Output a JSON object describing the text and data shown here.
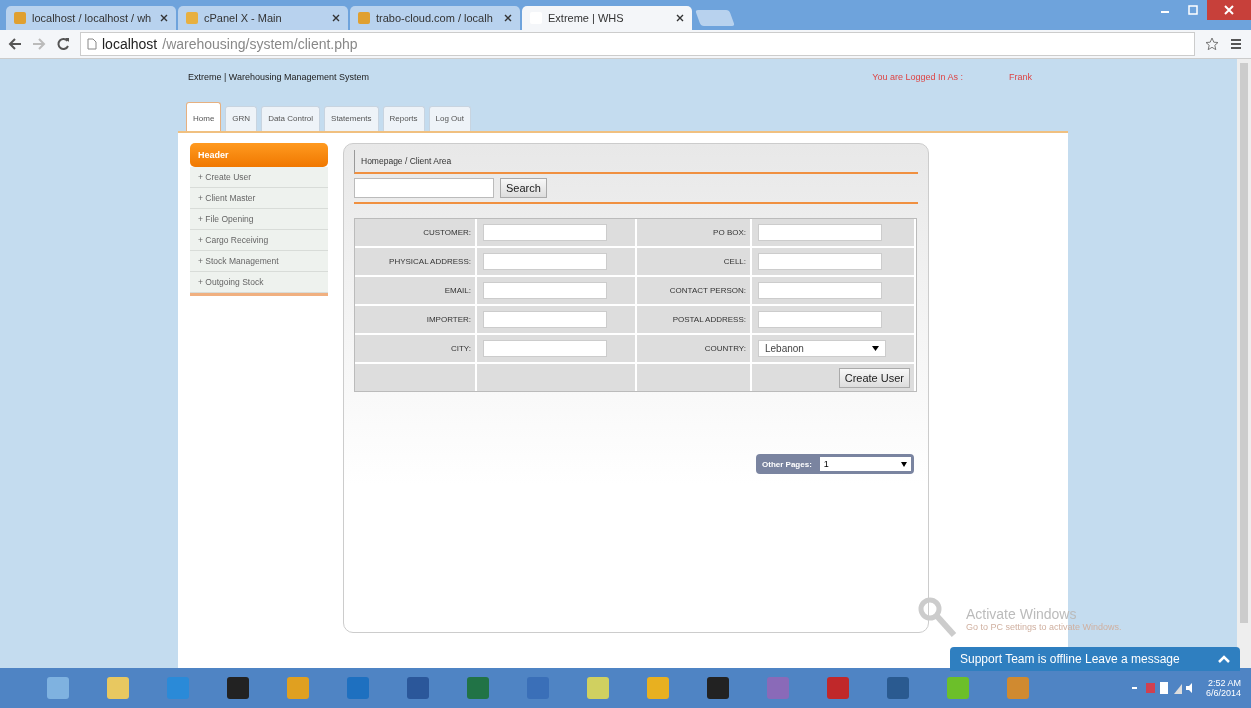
{
  "browser_tabs": [
    {
      "title": "localhost / localhost / wh",
      "selected": false
    },
    {
      "title": "cPanel X - Main",
      "selected": false
    },
    {
      "title": "trabo-cloud.com / localh",
      "selected": false
    },
    {
      "title": "Extreme | WHS",
      "selected": true
    }
  ],
  "address_bar": {
    "host": "localhost",
    "path": "/warehousing/system/client.php"
  },
  "site": {
    "title": "Extreme | Warehousing Management System",
    "login_label": "You are Logged In As :",
    "user": "Frank"
  },
  "nav_tabs": [
    {
      "label": "Home",
      "selected": true
    },
    {
      "label": "GRN",
      "selected": false
    },
    {
      "label": "Data Control",
      "selected": false
    },
    {
      "label": "Statements",
      "selected": false
    },
    {
      "label": "Reports",
      "selected": false
    },
    {
      "label": "Log Out",
      "selected": false
    }
  ],
  "sidebar": {
    "header": "Header",
    "items": [
      "+ Create User",
      "+ Client Master",
      "+ File Opening",
      "+ Cargo Receiving",
      "+ Stock Management",
      "+ Outgoing Stock"
    ]
  },
  "breadcrumb": "Homepage / Client Area",
  "search": {
    "button": "Search"
  },
  "form": {
    "rows": [
      {
        "left": {
          "label": "CUSTOMER:"
        },
        "right": {
          "label": "PO BOX:",
          "kind": "text"
        }
      },
      {
        "left": {
          "label": "PHYSICAL ADDRESS:"
        },
        "right": {
          "label": "CELL:",
          "kind": "text"
        }
      },
      {
        "left": {
          "label": "EMAIL:"
        },
        "right": {
          "label": "CONTACT PERSON:",
          "kind": "text"
        }
      },
      {
        "left": {
          "label": "IMPORTER:"
        },
        "right": {
          "label": "POSTAL ADDRESS:",
          "kind": "text"
        }
      },
      {
        "left": {
          "label": "CITY:"
        },
        "right": {
          "label": "COUNTRY:",
          "kind": "select",
          "value": "Lebanon"
        }
      }
    ],
    "submit": "Create User"
  },
  "pager": {
    "label": "Other Pages:",
    "value": "1"
  },
  "activation": {
    "title": "Activate Windows",
    "subtitle": "Go to PC settings to activate Windows."
  },
  "chat": {
    "text": "Support Team is offline Leave a message"
  },
  "taskbar": {
    "time": "2:52 AM",
    "date": "6/6/2014"
  }
}
